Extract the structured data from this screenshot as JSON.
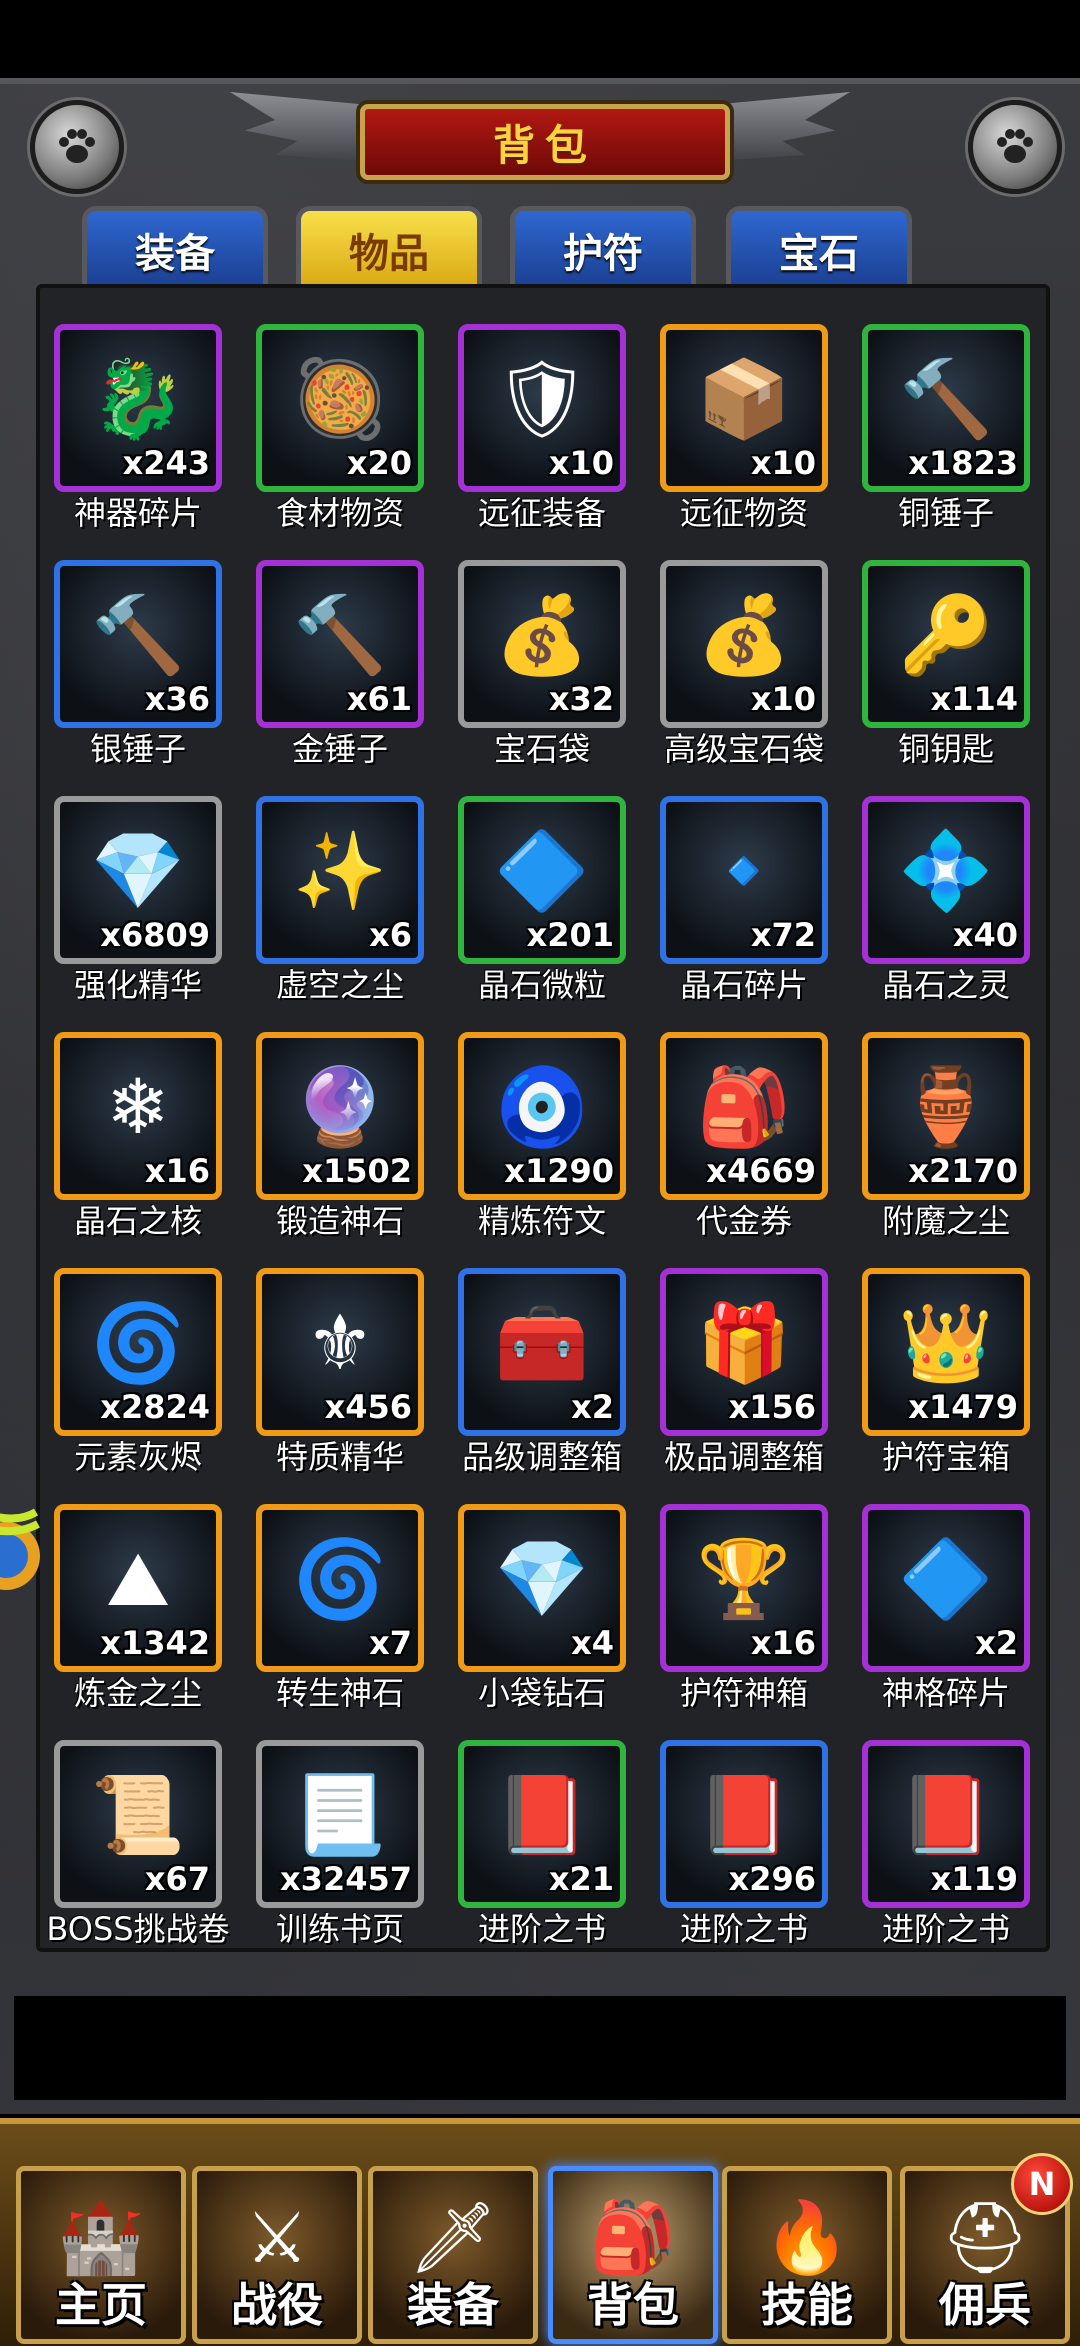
{
  "header": {
    "title": "背包"
  },
  "tabs": [
    {
      "label": "装备",
      "active": false
    },
    {
      "label": "物品",
      "active": true
    },
    {
      "label": "护符",
      "active": false
    },
    {
      "label": "宝石",
      "active": false
    }
  ],
  "items": [
    {
      "name": "神器碎片",
      "count": "x243",
      "rarity": "purple",
      "icon": "artifact-shard-icon",
      "glyph": "🐉"
    },
    {
      "name": "食材物资",
      "count": "x20",
      "rarity": "green",
      "icon": "food-supplies-icon",
      "glyph": "🥘"
    },
    {
      "name": "远征装备",
      "count": "x10",
      "rarity": "purple",
      "icon": "expedition-gear-icon",
      "glyph": "🛡"
    },
    {
      "name": "远征物资",
      "count": "x10",
      "rarity": "orange",
      "icon": "expedition-supplies-icon",
      "glyph": "📦"
    },
    {
      "name": "铜锤子",
      "count": "x1823",
      "rarity": "green",
      "icon": "copper-hammer-icon",
      "glyph": "🔨"
    },
    {
      "name": "银锤子",
      "count": "x36",
      "rarity": "blue",
      "icon": "silver-hammer-icon",
      "glyph": "🔨"
    },
    {
      "name": "金锤子",
      "count": "x61",
      "rarity": "purple",
      "icon": "gold-hammer-icon",
      "glyph": "🔨"
    },
    {
      "name": "宝石袋",
      "count": "x32",
      "rarity": "gray",
      "icon": "gem-bag-icon",
      "glyph": "💰"
    },
    {
      "name": "高级宝石袋",
      "count": "x10",
      "rarity": "gray",
      "icon": "premium-gem-bag-icon",
      "glyph": "💰"
    },
    {
      "name": "铜钥匙",
      "count": "x114",
      "rarity": "green",
      "icon": "copper-key-icon",
      "glyph": "🔑"
    },
    {
      "name": "强化精华",
      "count": "x6809",
      "rarity": "gray",
      "icon": "enhance-essence-icon",
      "glyph": "💎"
    },
    {
      "name": "虚空之尘",
      "count": "x6",
      "rarity": "blue",
      "icon": "void-dust-icon",
      "glyph": "✨"
    },
    {
      "name": "晶石微粒",
      "count": "x201",
      "rarity": "green",
      "icon": "crystal-particle-icon",
      "glyph": "🔷"
    },
    {
      "name": "晶石碎片",
      "count": "x72",
      "rarity": "blue",
      "icon": "crystal-fragment-icon",
      "glyph": "🔹"
    },
    {
      "name": "晶石之灵",
      "count": "x40",
      "rarity": "purple",
      "icon": "crystal-spirit-icon",
      "glyph": "💠"
    },
    {
      "name": "晶石之核",
      "count": "x16",
      "rarity": "orange",
      "icon": "crystal-core-icon",
      "glyph": "❄"
    },
    {
      "name": "锻造神石",
      "count": "x1502",
      "rarity": "orange",
      "icon": "forging-stone-icon",
      "glyph": "🔮"
    },
    {
      "name": "精炼符文",
      "count": "x1290",
      "rarity": "orange",
      "icon": "refining-rune-icon",
      "glyph": "🧿"
    },
    {
      "name": "代金券",
      "count": "x4669",
      "rarity": "orange",
      "icon": "voucher-bag-icon",
      "glyph": "🎒"
    },
    {
      "name": "附魔之尘",
      "count": "x2170",
      "rarity": "orange",
      "icon": "enchant-dust-icon",
      "glyph": "🏺"
    },
    {
      "name": "元素灰烬",
      "count": "x2824",
      "rarity": "orange",
      "icon": "element-ash-icon",
      "glyph": "🌀"
    },
    {
      "name": "特质精华",
      "count": "x456",
      "rarity": "orange",
      "icon": "trait-essence-icon",
      "glyph": "⚜"
    },
    {
      "name": "品级调整箱",
      "count": "x2",
      "rarity": "blue",
      "icon": "grade-adjust-chest-icon",
      "glyph": "🧰"
    },
    {
      "name": "极品调整箱",
      "count": "x156",
      "rarity": "purple",
      "icon": "supreme-adjust-chest-icon",
      "glyph": "🎁"
    },
    {
      "name": "护符宝箱",
      "count": "x1479",
      "rarity": "orange",
      "icon": "amulet-chest-icon",
      "glyph": "👑"
    },
    {
      "name": "炼金之尘",
      "count": "x1342",
      "rarity": "orange",
      "icon": "alchemy-dust-icon",
      "glyph": "⛰"
    },
    {
      "name": "转生神石",
      "count": "x7",
      "rarity": "orange",
      "icon": "rebirth-stone-icon",
      "glyph": "🌀"
    },
    {
      "name": "小袋钻石",
      "count": "x4",
      "rarity": "orange",
      "icon": "diamond-pouch-icon",
      "glyph": "💎"
    },
    {
      "name": "护符神箱",
      "count": "x16",
      "rarity": "purple",
      "icon": "amulet-divine-chest-icon",
      "glyph": "🏆"
    },
    {
      "name": "神格碎片",
      "count": "x2",
      "rarity": "purple",
      "icon": "divinity-shard-icon",
      "glyph": "🔷"
    },
    {
      "name": "BOSS挑战卷",
      "count": "x67",
      "rarity": "gray",
      "icon": "boss-scroll-icon",
      "glyph": "📜"
    },
    {
      "name": "训练书页",
      "count": "x32457",
      "rarity": "gray",
      "icon": "training-page-icon",
      "glyph": "📃"
    },
    {
      "name": "进阶之书",
      "count": "x21",
      "rarity": "green",
      "icon": "advance-book-icon",
      "glyph": "📕"
    },
    {
      "name": "进阶之书",
      "count": "x296",
      "rarity": "blue",
      "icon": "advance-book-icon",
      "glyph": "📕"
    },
    {
      "name": "进阶之书",
      "count": "x119",
      "rarity": "purple",
      "icon": "advance-book-icon",
      "glyph": "📕"
    }
  ],
  "nav": [
    {
      "label": "主页",
      "icon": "home-icon",
      "glyph": "🏰",
      "active": false,
      "badge": ""
    },
    {
      "label": "战役",
      "icon": "battle-icon",
      "glyph": "⚔",
      "active": false,
      "badge": ""
    },
    {
      "label": "装备",
      "icon": "equipment-icon",
      "glyph": "🗡",
      "active": false,
      "badge": ""
    },
    {
      "label": "背包",
      "icon": "backpack-icon",
      "glyph": "🎒",
      "active": true,
      "badge": ""
    },
    {
      "label": "技能",
      "icon": "skill-icon",
      "glyph": "🔥",
      "active": false,
      "badge": ""
    },
    {
      "label": "佣兵",
      "icon": "mercenary-icon",
      "glyph": "⛑",
      "active": false,
      "badge": "N"
    }
  ]
}
